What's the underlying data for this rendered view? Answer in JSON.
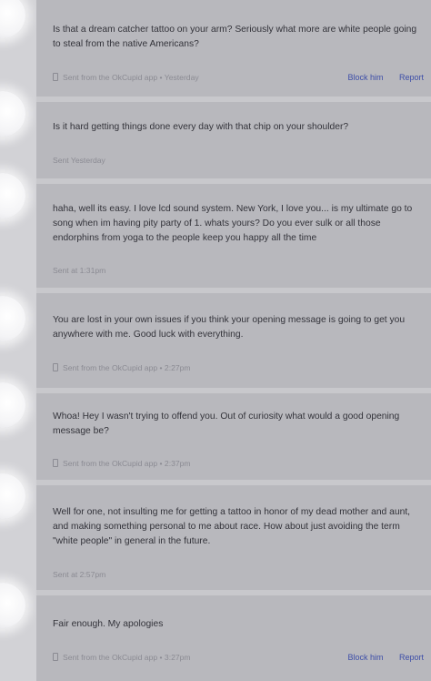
{
  "messages": [
    {
      "text": "Is that a dream catcher tattoo on your arm? Seriously what more are white people going to steal from the native Americans?",
      "meta": "Sent from the OkCupid app • Yesterday",
      "has_app_icon": true,
      "actions": [
        "Block him",
        "Report"
      ]
    },
    {
      "text": "Is it hard getting things done every day with that chip on your shoulder?",
      "meta": "Sent Yesterday",
      "has_app_icon": false,
      "actions": []
    },
    {
      "text": "haha, well its easy. I love lcd sound system. New York, I love you... is my ultimate go to song when im having pity party of 1. whats yours? Do you ever sulk or all those endorphins from yoga to the people keep you happy all the time",
      "meta": "Sent at 1:31pm",
      "has_app_icon": false,
      "actions": []
    },
    {
      "text": "You are lost in your own issues if you think your opening message is going to get you anywhere with me. Good luck with everything.",
      "meta": "Sent from the OkCupid app • 2:27pm",
      "has_app_icon": true,
      "actions": []
    },
    {
      "text": "Whoa! Hey I wasn't trying to offend you. Out of curiosity what would a good opening message be?",
      "meta": "Sent from the OkCupid app • 2:37pm",
      "has_app_icon": true,
      "actions": []
    },
    {
      "text": "Well for one, not insulting me for getting a tattoo in honor of my dead mother and aunt, and making something personal to me about race. How about just avoiding the term \"white people\" in general in the future.",
      "meta": "Sent at 2:57pm",
      "has_app_icon": false,
      "actions": []
    },
    {
      "text": "Fair enough. My apologies",
      "meta": "Sent from the OkCupid app • 3:27pm",
      "has_app_icon": true,
      "actions": [
        "Block him",
        "Report"
      ]
    }
  ],
  "colors": {
    "card": "#b8b8bd",
    "background": "#c8c8cc",
    "text": "#33333a",
    "meta": "#8b8b93",
    "link": "#3d4ea8"
  },
  "icons": {
    "app": "phone-icon",
    "avatar": "avatar"
  }
}
